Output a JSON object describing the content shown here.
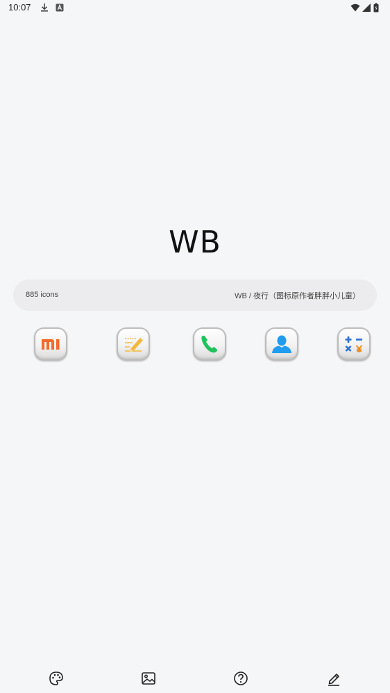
{
  "status_bar": {
    "time": "10:07"
  },
  "pack": {
    "title": "WB",
    "icon_count": "885 icons",
    "author": "WB / 夜行（图标原作者胖胖小儿童）"
  },
  "icons": [
    {
      "name": "mi-app",
      "label": "mi"
    },
    {
      "name": "notes-app"
    },
    {
      "name": "phone-app"
    },
    {
      "name": "contacts-app"
    },
    {
      "name": "calculator-app",
      "symbols": [
        "+",
        "−",
        "×",
        "¥"
      ]
    }
  ],
  "bottom_nav": [
    {
      "icon": "palette-icon"
    },
    {
      "icon": "image-icon"
    },
    {
      "icon": "help-icon"
    },
    {
      "icon": "edit-icon"
    }
  ],
  "colors": {
    "background": "#f5f6f8",
    "pill": "#ececee",
    "mi_orange": "#f46a2b",
    "notes_yellow": "#f5b73a",
    "phone_green": "#1fc35b",
    "contacts_blue": "#1f9cf0",
    "calc_blue": "#2a6fd6",
    "calc_orange": "#f08a1c"
  }
}
